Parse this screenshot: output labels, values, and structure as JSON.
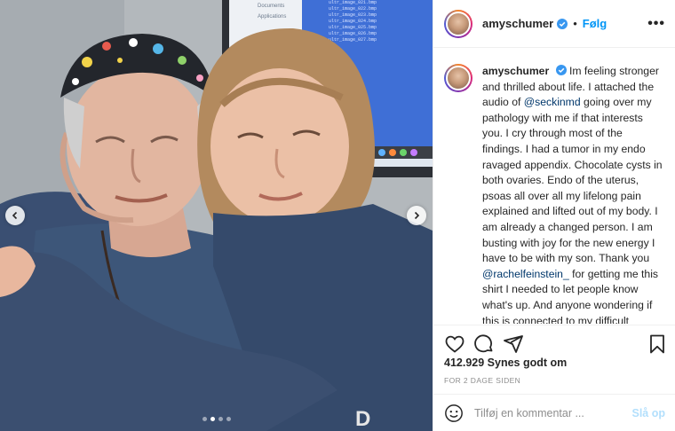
{
  "post": {
    "username": "amyschumer",
    "separator": "•",
    "follow_label": "Følg",
    "more_icon": "more-options-icon",
    "caption_parts": [
      {
        "type": "text",
        "text": "Im feeling stronger and thrilled about life. I attached the audio of "
      },
      {
        "type": "mention",
        "text": "@seckinmd"
      },
      {
        "type": "text",
        "text": " going over my pathology with me if that interests you. I cry through most of the findings. I had a tumor in my endo ravaged appendix. Chocolate cysts in both ovaries. Endo of the uterus, psoas all over all my lifelong pain explained and lifted out of my body. I am already a changed person. I am busting with joy for the new energy I have to be with my son. Thank you "
      },
      {
        "type": "mention",
        "text": "@rachelfeinstein_"
      },
      {
        "type": "text",
        "text": " for getting me this shirt I needed to let people know what's up. And anyone wondering if this is connected to my difficult pregnancy and hyperemesis I say fuck yes! I can't answer medically because there is no research on this shit because they only happen TO"
      }
    ],
    "likes": "412.929 Synes godt om",
    "timestamp": "FOR 2 DAGE SIDEN",
    "comment_placeholder": "Tilføj en kommentar ...",
    "post_label": "Slå op",
    "carousel": {
      "count": 4,
      "active_index": 1
    }
  },
  "photo_screen": {
    "sidebar": [
      "Documents",
      "Applications"
    ],
    "files": [
      "ultr_image_021.bmp",
      "ultr_image_022.bmp",
      "ultr_image_023.bmp",
      "ultr_image_024.bmp",
      "ultr_image_025.bmp",
      "ultr_image_026.bmp",
      "ultr_image_027.bmp"
    ]
  },
  "colors": {
    "accent": "#0095f6",
    "post_disabled": "#b2dffc",
    "verified": "#3897f0",
    "scrubs": "#3d5679",
    "muted": "#8e8e8e"
  },
  "icons": [
    "chevron-left-icon",
    "chevron-right-icon",
    "heart-icon",
    "comment-icon",
    "share-icon",
    "bookmark-icon",
    "emoji-icon",
    "verified-badge-icon"
  ]
}
